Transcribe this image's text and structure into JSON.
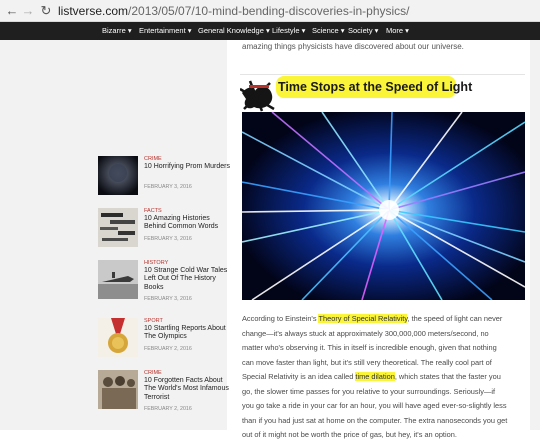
{
  "browser": {
    "url_domain": "listverse.com",
    "url_path": "/2013/05/07/10-mind-bending-discoveries-in-physics/"
  },
  "nav": {
    "items": [
      {
        "label": "Bizarre ▾"
      },
      {
        "label": "Entertainment ▾"
      },
      {
        "label": "General Knowledge ▾"
      },
      {
        "label": "Lifestyle ▾"
      },
      {
        "label": "Science ▾"
      },
      {
        "label": "Society ▾"
      },
      {
        "label": "More ▾"
      }
    ]
  },
  "sidebar": {
    "items": [
      {
        "category": "CRIME",
        "title": "10 Horrifying Prom Murders",
        "date": "FEBRUARY 3, 2016"
      },
      {
        "category": "FACTS",
        "title": "10 Amazing Histories Behind Common Words",
        "date": "FEBRUARY 3, 2016"
      },
      {
        "category": "HISTORY",
        "title": "10 Strange Cold War Tales Left Out Of The History Books",
        "date": "FEBRUARY 3, 2016"
      },
      {
        "category": "SPORT",
        "title": "10 Startling Reports About The Olympics",
        "date": "FEBRUARY 2, 2016"
      },
      {
        "category": "CRIME",
        "title": "10 Forgotten Facts About The World's Most Infamous Terrorist",
        "date": "FEBRUARY 2, 2016"
      }
    ]
  },
  "article": {
    "intro": "amazing things physicists have discovered about our universe.",
    "heading": "Time Stops at the Speed of Light",
    "lines": [
      {
        "parts": [
          "According to Einstein's ",
          "Theory of Special Relativity",
          ", the speed of light can never"
        ]
      },
      {
        "text": "change—it's always stuck at approximately 300,000,000 meters/second, no"
      },
      {
        "text": "matter who's observing it. This in itself is incredible enough, given that nothing"
      },
      {
        "text": "can move faster than light, but it's still very theoretical. The really cool part of"
      },
      {
        "parts": [
          "Special Relativity is an idea called ",
          "time dilation",
          ", which states that the faster you"
        ]
      },
      {
        "text": "go, the slower time passes for you relative to your surroundings. Seriously—if"
      },
      {
        "text": "you go take a ride in your car for an hour, you will have aged ever-so-slightly less"
      },
      {
        "text": "than if you had just sat at home on the computer. The extra nanoseconds you get"
      },
      {
        "text": "out of it might not be worth the price of gas, but hey, it's an option."
      }
    ]
  },
  "colors": {
    "nav_bg": "#1f1f1f",
    "highlight": "#fbf53a",
    "category": "#b8322c"
  }
}
